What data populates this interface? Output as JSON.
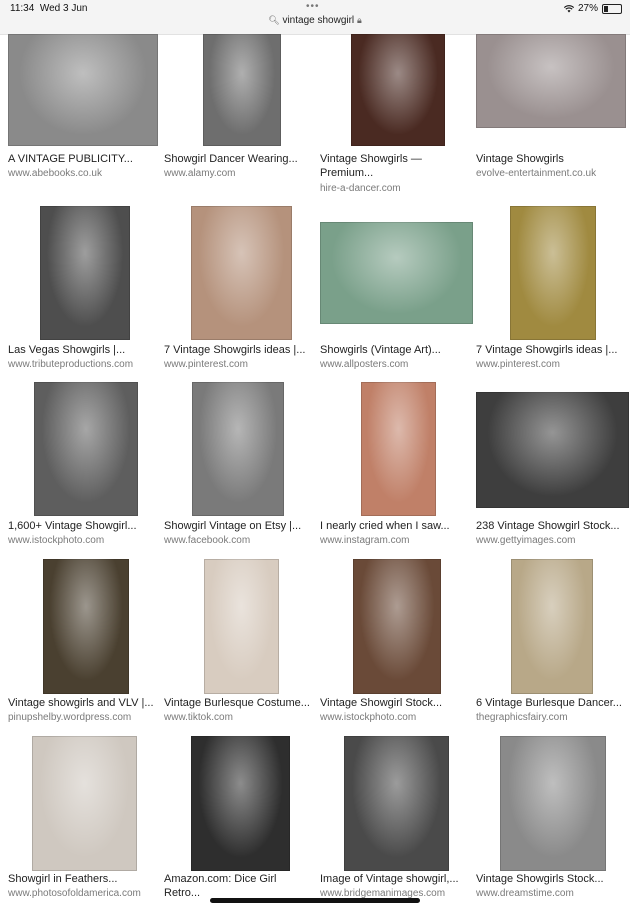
{
  "status": {
    "time": "11:34",
    "date": "Wed 3 Jun",
    "battery": "27%",
    "battery_level": 0.27,
    "dots": "•••"
  },
  "url": {
    "text": "vintage showgirl"
  },
  "results": [
    {
      "title": "A VINTAGE PUBLICITY...",
      "title2": "",
      "domain": "www.abebooks.co.uk",
      "color": "#8a8a8a"
    },
    {
      "title": "Showgirl Dancer Wearing...",
      "title2": "",
      "domain": "www.alamy.com",
      "color": "#6e6e6e"
    },
    {
      "title": "Vintage Showgirls —",
      "title2": "Premium...",
      "domain": "hire-a-dancer.com",
      "color": "#4a2a22"
    },
    {
      "title": "Vintage Showgirls",
      "title2": "",
      "domain": "evolve-entertainment.co.uk",
      "color": "#9a9090"
    },
    {
      "title": "Las Vegas Showgirls |...",
      "title2": "",
      "domain": "www.tributeproductions.com",
      "color": "#4e4e4e"
    },
    {
      "title": "7 Vintage Showgirls ideas |...",
      "title2": "",
      "domain": "www.pinterest.com",
      "color": "#b5927c"
    },
    {
      "title": "Showgirls (Vintage Art)...",
      "title2": "",
      "domain": "www.allposters.com",
      "color": "#7aa08a"
    },
    {
      "title": "7 Vintage Showgirls ideas |...",
      "title2": "",
      "domain": "www.pinterest.com",
      "color": "#a08a40"
    },
    {
      "title": "1,600+ Vintage Showgirl...",
      "title2": "",
      "domain": "www.istockphoto.com",
      "color": "#5e5e5e"
    },
    {
      "title": "Showgirl Vintage on Etsy |...",
      "title2": "",
      "domain": "www.facebook.com",
      "color": "#7a7a7a"
    },
    {
      "title": "I nearly cried when I saw...",
      "title2": "",
      "domain": "www.instagram.com",
      "color": "#c08068"
    },
    {
      "title": "238 Vintage Showgirl Stock...",
      "title2": "",
      "domain": "www.gettyimages.com",
      "color": "#3e3e3e"
    },
    {
      "title": "Vintage showgirls and VLV |...",
      "title2": "",
      "domain": "pinupshelby.wordpress.com",
      "color": "#4a4030"
    },
    {
      "title": "Vintage Burlesque Costume...",
      "title2": "",
      "domain": "www.tiktok.com",
      "color": "#d8ccc0"
    },
    {
      "title": "Vintage Showgirl Stock...",
      "title2": "",
      "domain": "www.istockphoto.com",
      "color": "#6a4a38"
    },
    {
      "title": "6 Vintage Burlesque Dancer...",
      "title2": "",
      "domain": "thegraphicsfairy.com",
      "color": "#b8a888"
    },
    {
      "title": "Showgirl in Feathers...",
      "title2": "",
      "domain": "www.photosofoldamerica.com",
      "color": "#cfc8c0"
    },
    {
      "title": "Amazon.com: Dice Girl",
      "title2": "Retro...",
      "domain": "",
      "color": "#2e2e2e"
    },
    {
      "title": "Image of Vintage showgirl,...",
      "title2": "",
      "domain": "www.bridgemanimages.com",
      "color": "#4a4a4a"
    },
    {
      "title": "Vintage Showgirls Stock...",
      "title2": "",
      "domain": "www.dreamstime.com",
      "color": "#8a8a8a"
    }
  ]
}
